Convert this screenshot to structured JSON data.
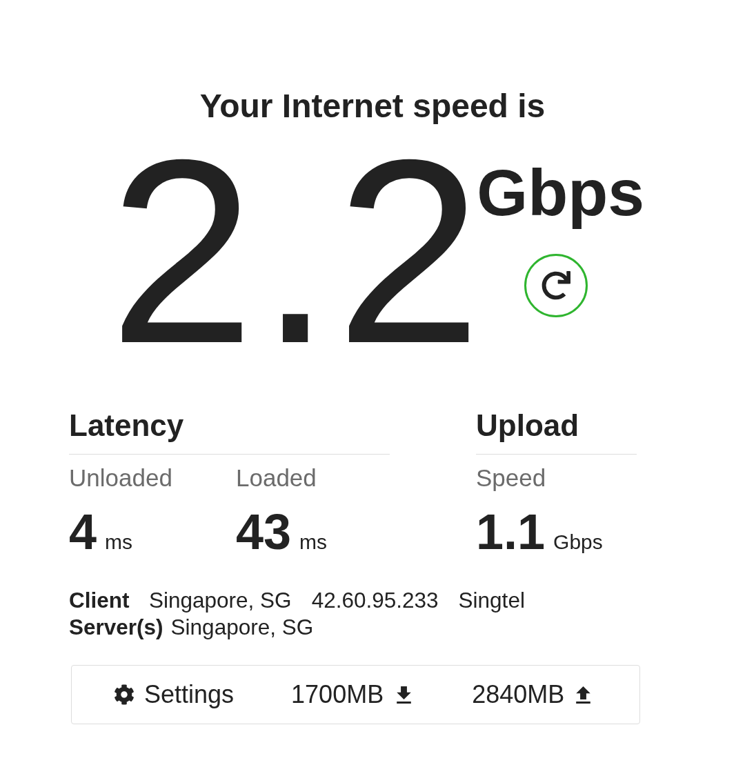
{
  "heading": "Your Internet speed is",
  "speed": {
    "value": "2.2",
    "unit": "Gbps"
  },
  "sections": [
    {
      "title": "Latency",
      "metrics": [
        {
          "label": "Unloaded",
          "value": "4",
          "unit": "ms"
        },
        {
          "label": "Loaded",
          "value": "43",
          "unit": "ms"
        }
      ]
    },
    {
      "title": "Upload",
      "metrics": [
        {
          "label": "Speed",
          "value": "1.1",
          "unit": "Gbps"
        }
      ]
    }
  ],
  "info": [
    {
      "label": "Client",
      "values": [
        "Singapore, SG",
        "42.60.95.233",
        "Singtel"
      ]
    },
    {
      "label": "Server(s)",
      "values": [
        "Singapore, SG"
      ]
    }
  ],
  "footer": {
    "settings": "Settings",
    "download": "1700MB",
    "upload": "2840MB"
  }
}
